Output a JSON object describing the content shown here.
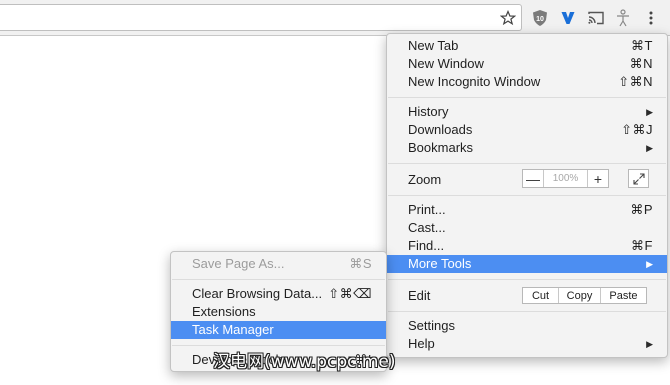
{
  "toolbar": {
    "icons": [
      "star-icon",
      "ublock-icon",
      "vimium-icon",
      "cast-icon",
      "accessibility-icon",
      "menu-dots-icon"
    ]
  },
  "main_menu": {
    "new_tab": {
      "label": "New Tab",
      "shortcut": "⌘T"
    },
    "new_window": {
      "label": "New Window",
      "shortcut": "⌘N"
    },
    "new_incognito": {
      "label": "New Incognito Window",
      "shortcut": "⇧⌘N"
    },
    "history": {
      "label": "History"
    },
    "downloads": {
      "label": "Downloads",
      "shortcut": "⇧⌘J"
    },
    "bookmarks": {
      "label": "Bookmarks"
    },
    "zoom": {
      "label": "Zoom",
      "minus": "—",
      "value": "100%",
      "plus": "+"
    },
    "print": {
      "label": "Print...",
      "shortcut": "⌘P"
    },
    "cast": {
      "label": "Cast..."
    },
    "find": {
      "label": "Find...",
      "shortcut": "⌘F"
    },
    "more_tools": {
      "label": "More Tools"
    },
    "edit": {
      "label": "Edit",
      "cut": "Cut",
      "copy": "Copy",
      "paste": "Paste"
    },
    "settings": {
      "label": "Settings"
    },
    "help": {
      "label": "Help"
    }
  },
  "sub_menu": {
    "save_page": {
      "label": "Save Page As...",
      "shortcut": "⌘S"
    },
    "clear_browsing": {
      "label": "Clear Browsing Data...",
      "shortcut": "⇧⌘⌫"
    },
    "extensions": {
      "label": "Extensions"
    },
    "task_manager": {
      "label": "Task Manager"
    },
    "developer_tools": {
      "label": "Developer Tools",
      "shortcut": "⌥⌘I"
    }
  },
  "watermark": {
    "text": "汉电网(www.pcpc.me)"
  },
  "colors": {
    "highlight": "#4c8ef2",
    "menu_bg": "#f3f3f3",
    "ublock": "#7b7b7b",
    "vimium": "#1a6fd8"
  }
}
